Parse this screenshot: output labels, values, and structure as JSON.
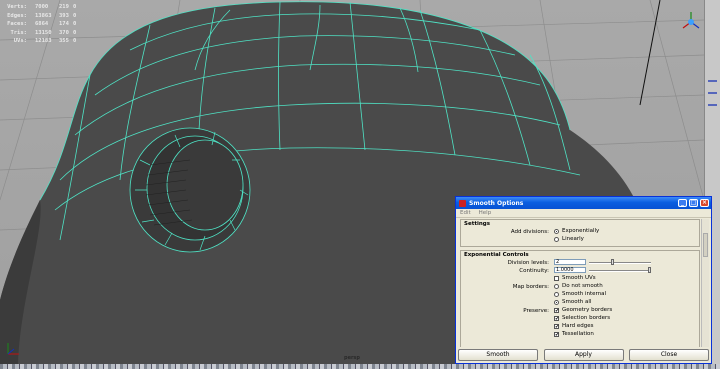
{
  "hud": {
    "rows": [
      {
        "label": "Verts:",
        "value": "7000",
        "sel": "219",
        "pct": "0"
      },
      {
        "label": "Edges:",
        "value": "13863",
        "sel": "393",
        "pct": "0"
      },
      {
        "label": "Faces:",
        "value": "6864",
        "sel": "174",
        "pct": "0"
      },
      {
        "label": "Tris:",
        "value": "13150",
        "sel": "370",
        "pct": "0"
      },
      {
        "label": "UVs:",
        "value": "12183",
        "sel": "355",
        "pct": "0"
      }
    ]
  },
  "viewport": {
    "camera_label": "persp",
    "axis_gizmo": "view-cube-icon"
  },
  "dialog": {
    "title": "Smooth Options",
    "menu": [
      "Edit",
      "Help"
    ],
    "settings_section": {
      "title": "Settings",
      "add_divisions_label": "Add divisions:",
      "options": [
        "Exponentially",
        "Linearly"
      ],
      "selected_index": 0
    },
    "exponential_section": {
      "title": "Exponential Controls",
      "division_levels_label": "Division levels:",
      "division_levels_value": "2",
      "division_levels_slider": 0.38,
      "continuity_label": "Continuity:",
      "continuity_value": "1.0000",
      "continuity_slider": 1.0,
      "smooth_uvs_label": "Smooth UVs",
      "smooth_uvs_checked": false,
      "map_borders_label": "Map borders:",
      "map_border_options": [
        "Do not smooth",
        "Smooth internal",
        "Smooth all"
      ],
      "map_border_selected": 2,
      "preserve_label": "Preserve:",
      "preserve_options": [
        {
          "label": "Geometry borders",
          "checked": true
        },
        {
          "label": "Selection borders",
          "checked": true
        },
        {
          "label": "Hard edges",
          "checked": true
        },
        {
          "label": "Tessellation",
          "checked": true
        }
      ]
    },
    "buttons": {
      "smooth": "Smooth",
      "apply": "Apply",
      "close": "Close"
    }
  },
  "colors": {
    "wireframe": "#4fe3c5",
    "mesh": "#4c4c4c",
    "titlebar": "#0a5ee0",
    "dialog_bg": "#ece9d8"
  }
}
